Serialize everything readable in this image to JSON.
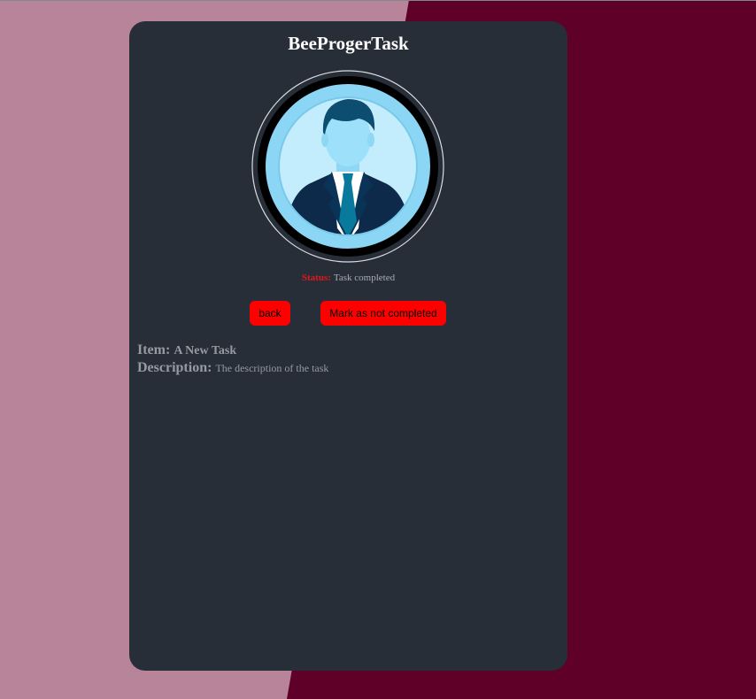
{
  "colors": {
    "background_left": "#b8849a",
    "background_right": "#5e0028",
    "card": "#272e38",
    "button": "#ff0000",
    "status_label": "#e0181a",
    "muted_text": "#969aa1"
  },
  "app": {
    "title": "BeeProgerTask"
  },
  "avatar": {
    "icon": "user-avatar-icon"
  },
  "status": {
    "label": "Status:",
    "value": "Task completed"
  },
  "buttons": {
    "back": "back",
    "toggle": "Mark as not completed"
  },
  "task": {
    "item_label": "Item:",
    "item_value": "A New Task",
    "description_label": "Description:",
    "description_value": "The description of the task"
  }
}
